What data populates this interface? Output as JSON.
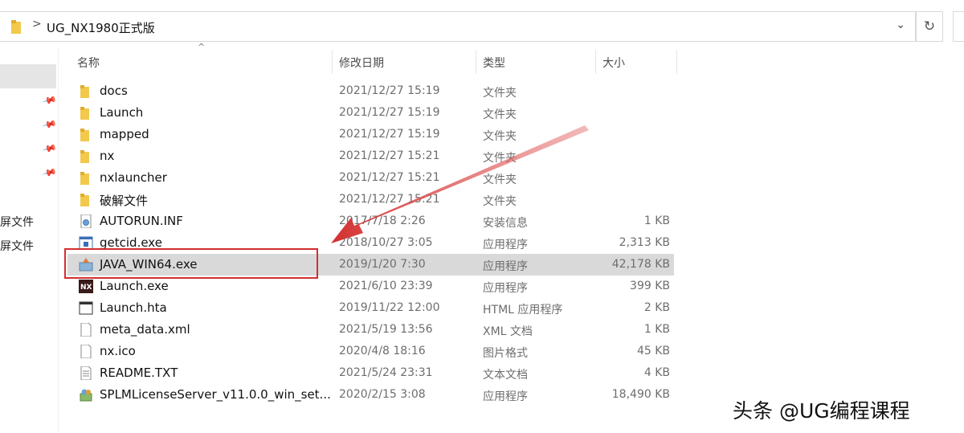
{
  "address_bar": {
    "path": "UG_NX1980正式版",
    "separator": ">"
  },
  "nav": {
    "items": [
      "屏文件",
      "屏文件"
    ]
  },
  "columns": {
    "name": "名称",
    "date": "修改日期",
    "type": "类型",
    "size": "大小"
  },
  "files": [
    {
      "name": "docs",
      "date": "2021/12/27 15:19",
      "type": "文件夹",
      "size": "",
      "icon": "folder-icon"
    },
    {
      "name": "Launch",
      "date": "2021/12/27 15:19",
      "type": "文件夹",
      "size": "",
      "icon": "folder-icon"
    },
    {
      "name": "mapped",
      "date": "2021/12/27 15:19",
      "type": "文件夹",
      "size": "",
      "icon": "folder-icon"
    },
    {
      "name": "nx",
      "date": "2021/12/27 15:21",
      "type": "文件夹",
      "size": "",
      "icon": "folder-icon"
    },
    {
      "name": "nxlauncher",
      "date": "2021/12/27 15:21",
      "type": "文件夹",
      "size": "",
      "icon": "folder-icon"
    },
    {
      "name": "破解文件",
      "date": "2021/12/27 15:21",
      "type": "文件夹",
      "size": "",
      "icon": "folder-icon"
    },
    {
      "name": "AUTORUN.INF",
      "date": "2017/7/18 2:26",
      "type": "安装信息",
      "size": "1 KB",
      "icon": "settings-file-icon"
    },
    {
      "name": "getcid.exe",
      "date": "2018/10/27 3:05",
      "type": "应用程序",
      "size": "2,313 KB",
      "icon": "app-window-icon"
    },
    {
      "name": "JAVA_WIN64.exe",
      "date": "2019/1/20 7:30",
      "type": "应用程序",
      "size": "42,178 KB",
      "icon": "installer-icon"
    },
    {
      "name": "Launch.exe",
      "date": "2021/6/10 23:39",
      "type": "应用程序",
      "size": "399 KB",
      "icon": "nx-app-icon"
    },
    {
      "name": "Launch.hta",
      "date": "2019/11/22 12:00",
      "type": "HTML 应用程序",
      "size": "2 KB",
      "icon": "hta-window-icon"
    },
    {
      "name": "meta_data.xml",
      "date": "2021/5/19 13:56",
      "type": "XML 文档",
      "size": "1 KB",
      "icon": "document-icon"
    },
    {
      "name": "nx.ico",
      "date": "2020/4/8 18:16",
      "type": "图片格式",
      "size": "45 KB",
      "icon": "document-icon"
    },
    {
      "name": "README.TXT",
      "date": "2021/5/24 23:31",
      "type": "文本文档",
      "size": "4 KB",
      "icon": "text-file-icon"
    },
    {
      "name": "SPLMLicenseServer_v11.0.0_win_set...",
      "date": "2020/2/15 3:08",
      "type": "应用程序",
      "size": "18,490 KB",
      "icon": "setup-icon"
    }
  ],
  "selected_index": 8,
  "watermark": "头条 @UG编程课程",
  "colors": {
    "folder": "#f2c94c",
    "selection": "#d9d9d9",
    "annotation": "#d32f2f"
  }
}
